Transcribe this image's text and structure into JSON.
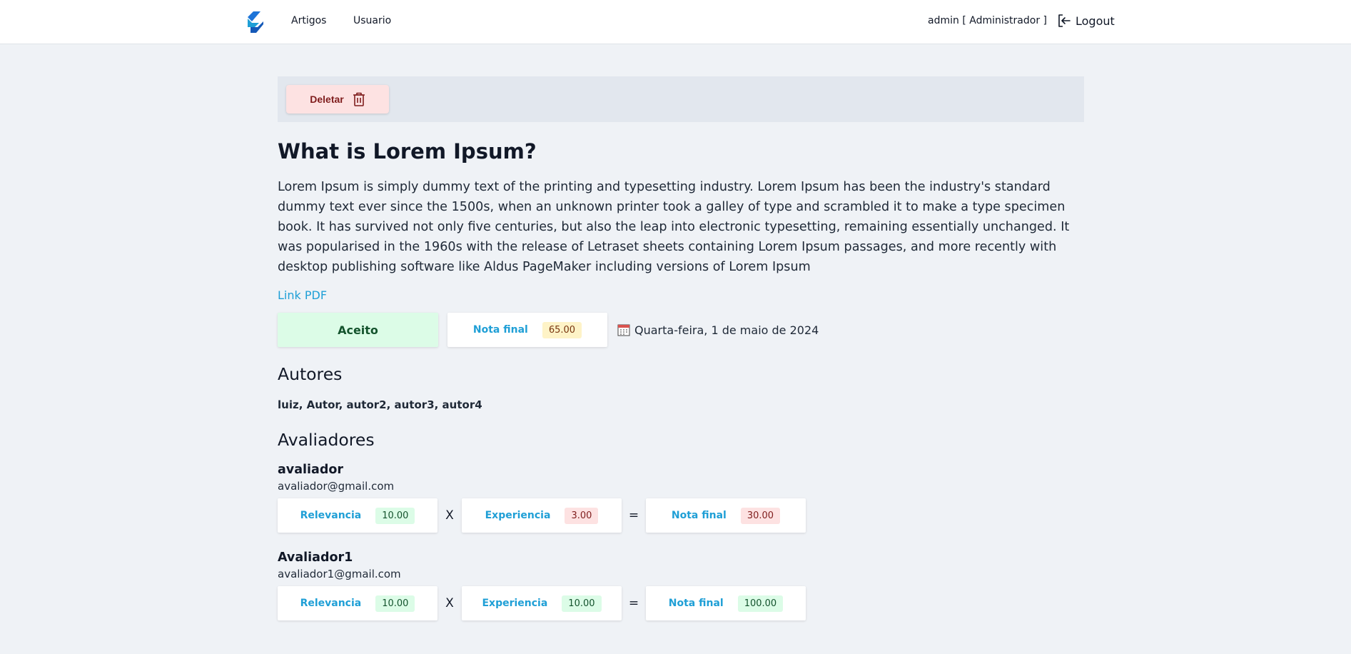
{
  "nav": {
    "links": [
      "Artigos",
      "Usuario"
    ],
    "user": "admin [ Administrador ]",
    "logout": "Logout"
  },
  "toolbar": {
    "delete_label": "Deletar"
  },
  "article": {
    "title": "What is Lorem Ipsum?",
    "body": "Lorem Ipsum is simply dummy text of the printing and typesetting industry. Lorem Ipsum has been the industry's standard dummy text ever since the 1500s, when an unknown printer took a galley of type and scrambled it to make a type specimen book. It has survived not only five centuries, but also the leap into electronic typesetting, remaining essentially unchanged. It was popularised in the 1960s with the release of Letraset sheets containing Lorem Ipsum passages, and more recently with desktop publishing software like Aldus PageMaker including versions of Lorem Ipsum",
    "link_pdf": "Link PDF",
    "status": "Aceito",
    "final_label": "Nota final",
    "final_score": "65.00",
    "date": "Quarta-feira, 1 de maio de 2024"
  },
  "authors": {
    "title": "Autores",
    "list": "luiz, Autor, autor2, autor3, autor4"
  },
  "reviewers": {
    "title": "Avaliadores",
    "items": [
      {
        "name": "avaliador",
        "email": "avaliador@gmail.com",
        "relevance_label": "Relevancia",
        "relevance": "10.00",
        "times": "X",
        "experience_label": "Experiencia",
        "experience": "3.00",
        "equals": "=",
        "final_label": "Nota final",
        "final": "30.00"
      },
      {
        "name": "Avaliador1",
        "email": "avaliador1@gmail.com",
        "relevance_label": "Relevancia",
        "relevance": "10.00",
        "times": "X",
        "experience_label": "Experiencia",
        "experience": "10.00",
        "equals": "=",
        "final_label": "Nota final",
        "final": "100.00"
      }
    ]
  },
  "colors": {
    "accent": "#1f9fd6",
    "accepted_bg": "#dcfce7",
    "delete_bg": "#fde2e2",
    "page_bg": "#eff2f6"
  },
  "icons": [
    "logo-icon",
    "logout-icon",
    "trash-icon",
    "calendar-icon"
  ]
}
